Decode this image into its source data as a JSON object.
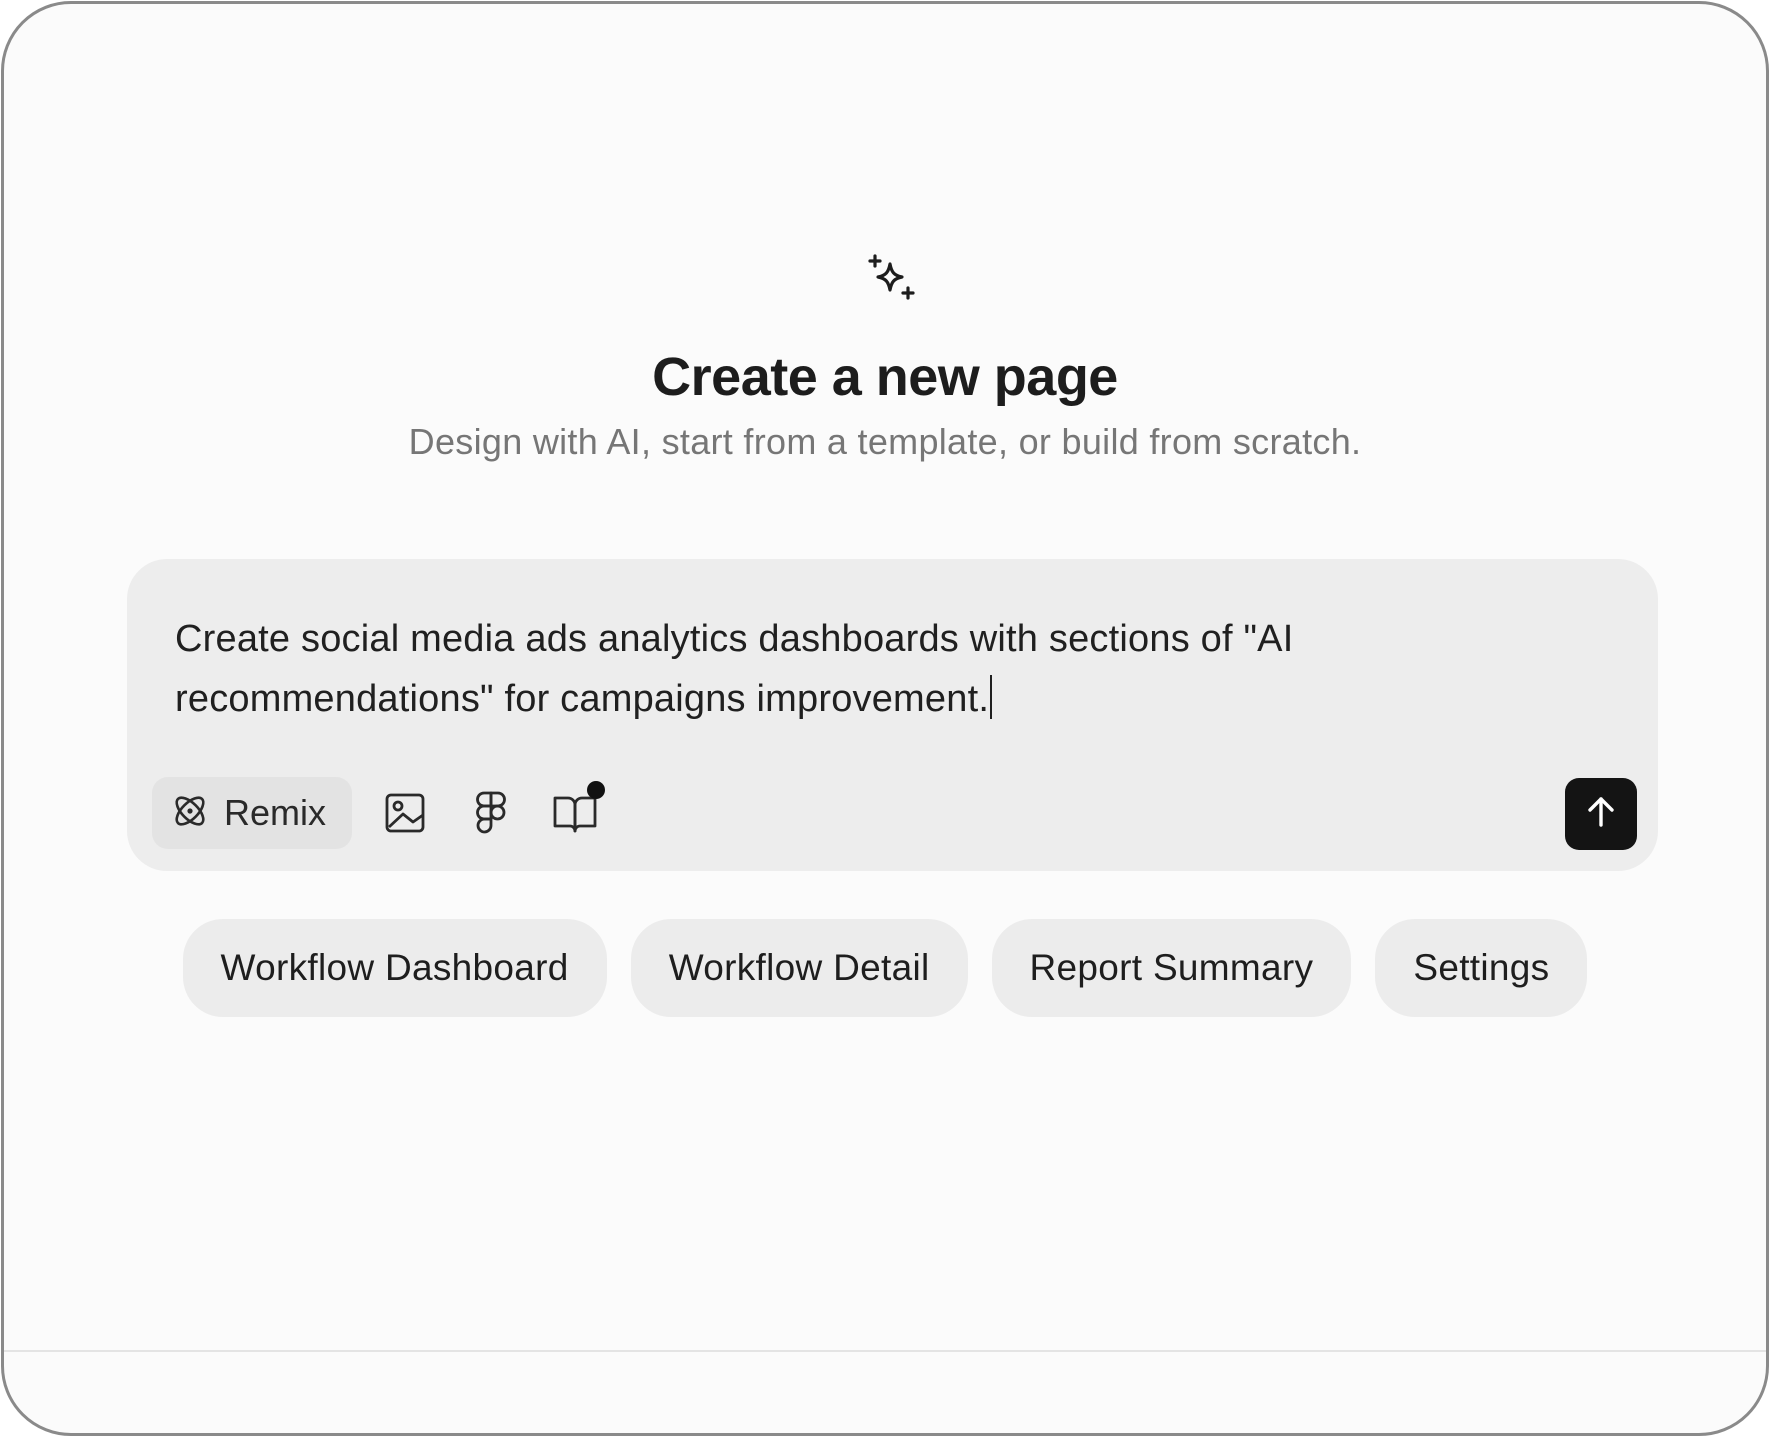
{
  "header": {
    "icon": "sparkles-icon",
    "title": "Create a new page",
    "subtitle": "Design with AI, start from a template, or build from scratch."
  },
  "composer": {
    "prompt_value": "Create social media ads analytics dashboards with sections of \"AI recommendations\" for campaigns improvement.",
    "toolbar": {
      "remix_label": "Remix",
      "remix_icon": "atom-icon",
      "image_icon": "image-icon",
      "figma_icon": "figma-icon",
      "library_icon": "book-icon",
      "library_has_notification": true,
      "send_icon": "arrow-up-icon"
    }
  },
  "suggestions": [
    {
      "label": "Workflow Dashboard"
    },
    {
      "label": "Workflow Detail"
    },
    {
      "label": "Report Summary"
    },
    {
      "label": "Settings"
    }
  ],
  "colors": {
    "background": "#fbfbfb",
    "composer_bg": "#ededed",
    "send_button": "#141414",
    "chip_bg": "#ececec"
  }
}
